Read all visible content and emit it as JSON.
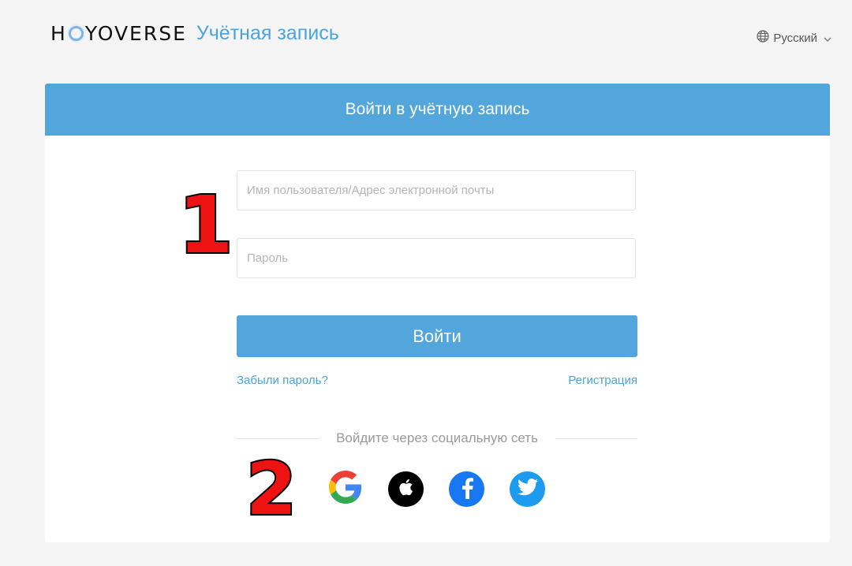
{
  "header": {
    "logo_text_pre": "H",
    "logo_text_post": "YOVERSE",
    "subtitle": "Учётная запись",
    "language": "Русский"
  },
  "login": {
    "title": "Войти в учётную запись",
    "username_placeholder": "Имя пользователя/Адрес электронной почты",
    "password_placeholder": "Пароль",
    "submit_label": "Войти",
    "forgot_label": "Забыли пароль?",
    "register_label": "Регистрация",
    "social_divider": "Войдите через социальную сеть",
    "social_providers": [
      "google-icon",
      "apple-icon",
      "facebook-icon",
      "twitter-icon"
    ]
  },
  "annotations": {
    "badge_1": "1",
    "badge_2": "2"
  },
  "colors": {
    "accent": "#52a6dc",
    "link": "#4ca3dd",
    "badge_fill": "#ee1212",
    "page_bg": "#f5f5f5"
  }
}
